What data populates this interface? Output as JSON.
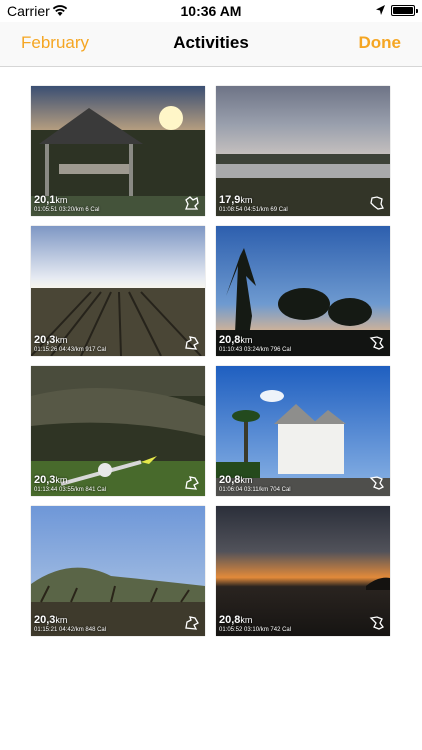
{
  "status_bar": {
    "carrier": "Carrier",
    "time": "10:36 AM"
  },
  "nav": {
    "back_label": "February",
    "title": "Activities",
    "done_label": "Done"
  },
  "colors": {
    "accent": "#f5a623"
  },
  "activities": [
    {
      "distance": "20,1",
      "unit": "km",
      "duration": "01:05:51",
      "pace": "03:20/km",
      "calories": "6 Cal"
    },
    {
      "distance": "17,9",
      "unit": "km",
      "duration": "01:08:54",
      "pace": "04:51/km",
      "calories": "69 Cal"
    },
    {
      "distance": "20,3",
      "unit": "km",
      "duration": "01:15:26",
      "pace": "04:43/km",
      "calories": "917 Cal"
    },
    {
      "distance": "20,8",
      "unit": "km",
      "duration": "01:10:43",
      "pace": "03:24/km",
      "calories": "796 Cal"
    },
    {
      "distance": "20,3",
      "unit": "km",
      "duration": "01:13:44",
      "pace": "03:55/km",
      "calories": "841 Cal"
    },
    {
      "distance": "20,8",
      "unit": "km",
      "duration": "01:06:04",
      "pace": "03:11/km",
      "calories": "704 Cal"
    },
    {
      "distance": "20,3",
      "unit": "km",
      "duration": "01:15:21",
      "pace": "04:42/km",
      "calories": "848 Cal"
    },
    {
      "distance": "20,8",
      "unit": "km",
      "duration": "01:05:52",
      "pace": "03:10/km",
      "calories": "742 Cal"
    }
  ]
}
